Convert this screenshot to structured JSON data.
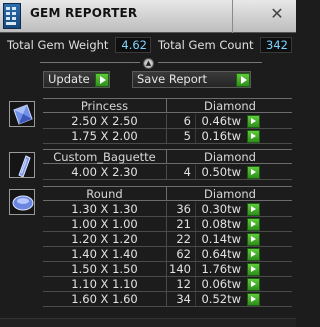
{
  "window": {
    "title": "GEM REPORTER",
    "close_label": "✕"
  },
  "totals": {
    "weight_label": "Total Gem Weight",
    "weight_value": "4.62",
    "count_label": "Total Gem Count",
    "count_value": "342"
  },
  "actions": {
    "update_label": "Update",
    "save_label": "Save Report"
  },
  "groups": [
    {
      "shape": "Princess",
      "material": "Diamond",
      "icon": "princess-cut-icon",
      "rows": [
        {
          "size": "2.50 X 2.50",
          "count": "6",
          "weight": "0.46tw"
        },
        {
          "size": "1.75 X 2.00",
          "count": "5",
          "weight": "0.16tw"
        }
      ]
    },
    {
      "shape": "Custom_Baguette",
      "material": "Diamond",
      "icon": "baguette-cut-icon",
      "rows": [
        {
          "size": "4.00 X 2.30",
          "count": "4",
          "weight": "0.50tw"
        }
      ]
    },
    {
      "shape": "Round",
      "material": "Diamond",
      "icon": "round-cut-icon",
      "rows": [
        {
          "size": "1.30 X 1.30",
          "count": "36",
          "weight": "0.30tw"
        },
        {
          "size": "1.00 X 1.00",
          "count": "21",
          "weight": "0.08tw"
        },
        {
          "size": "1.20 X 1.20",
          "count": "22",
          "weight": "0.14tw"
        },
        {
          "size": "1.40 X 1.40",
          "count": "62",
          "weight": "0.64tw"
        },
        {
          "size": "1.50 X 1.50",
          "count": "140",
          "weight": "1.76tw"
        },
        {
          "size": "1.10 X 1.10",
          "count": "12",
          "weight": "0.06tw"
        },
        {
          "size": "1.60 X 1.60",
          "count": "34",
          "weight": "0.52tw"
        }
      ]
    }
  ]
}
